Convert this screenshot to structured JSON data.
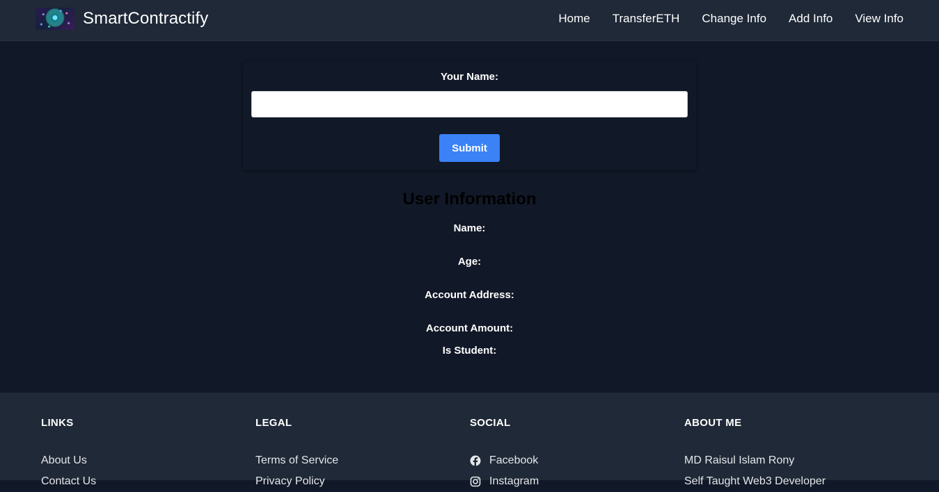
{
  "navbar": {
    "brand": "SmartContractify",
    "links": [
      "Home",
      "TransferETH",
      "Change Info",
      "Add Info",
      "View Info"
    ]
  },
  "form": {
    "label": "Your Name:",
    "input_value": "",
    "submit_label": "Submit"
  },
  "user_info": {
    "title": "User Information",
    "fields": [
      "Name:",
      "Age:",
      "Account Address:",
      "Account Amount:",
      "Is Student:"
    ]
  },
  "footer": {
    "links": {
      "heading": "LINKS",
      "items": [
        "About Us",
        "Contact Us"
      ]
    },
    "legal": {
      "heading": "LEGAL",
      "items": [
        "Terms of Service",
        "Privacy Policy"
      ]
    },
    "social": {
      "heading": "SOCIAL",
      "items": [
        {
          "label": "Facebook",
          "icon": "facebook-icon"
        },
        {
          "label": "Instagram",
          "icon": "instagram-icon"
        }
      ]
    },
    "about": {
      "heading": "ABOUT ME",
      "items": [
        "MD Raisul Islam Rony",
        "Self Taught Web3 Developer"
      ]
    }
  },
  "colors": {
    "page_bg": "#111827",
    "nav_bg": "#1f2937",
    "accent": "#3b82f6"
  }
}
